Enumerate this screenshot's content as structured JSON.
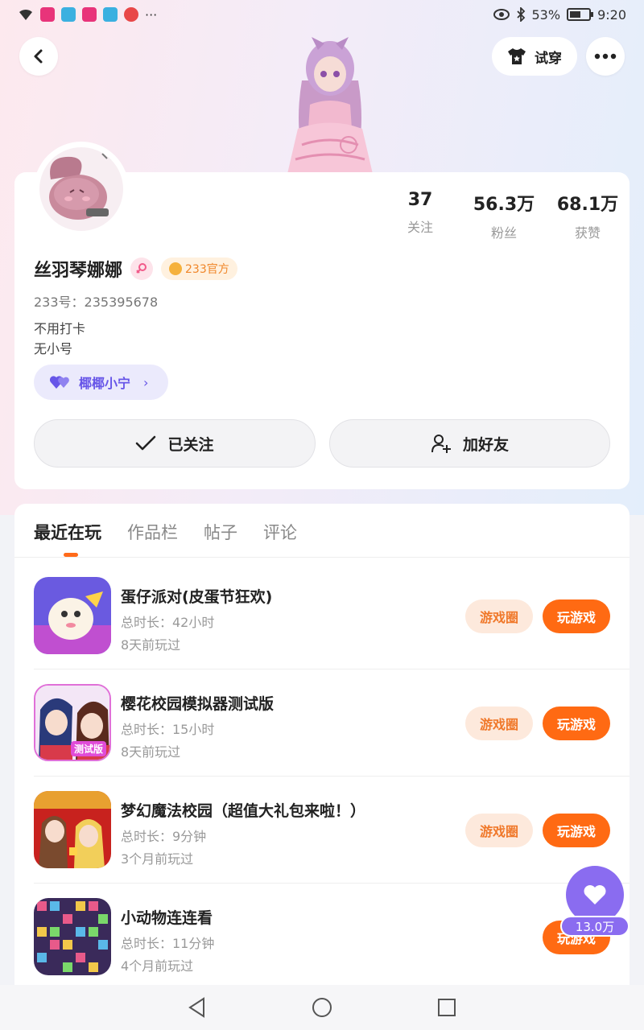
{
  "status_bar": {
    "battery_pct": "53%",
    "time": "9:20",
    "more_indicator": "···"
  },
  "header": {
    "back_icon": "chevron-left-icon",
    "try_on_label": "试穿",
    "more_icon": "more-dots-icon"
  },
  "profile": {
    "stats": [
      {
        "value": "37",
        "label": "关注"
      },
      {
        "value": "56.3万",
        "label": "粉丝"
      },
      {
        "value": "68.1万",
        "label": "获赞"
      }
    ],
    "username": "丝羽琴娜娜",
    "official_badge": "233官方",
    "user_id": "233号：235395678",
    "bio": [
      "不用打卡",
      "无小号"
    ],
    "cp_tag": "椰椰小宁",
    "follow_label": "已关注",
    "add_friend_label": "加好友"
  },
  "tabs": [
    {
      "label": "最近在玩",
      "active": true
    },
    {
      "label": "作品栏",
      "active": false
    },
    {
      "label": "帖子",
      "active": false
    },
    {
      "label": "评论",
      "active": false
    }
  ],
  "games": [
    {
      "title": "蛋仔派对(皮蛋节狂欢)",
      "duration": "总时长：42小时",
      "last_played": "8天前玩过",
      "circle_label": "游戏圈",
      "play_label": "玩游戏"
    },
    {
      "title": "樱花校园模拟器测试版",
      "duration": "总时长：15小时",
      "last_played": "8天前玩过",
      "circle_label": "游戏圈",
      "play_label": "玩游戏",
      "icon_text": "测试版"
    },
    {
      "title": "梦幻魔法校园（超值大礼包来啦！）",
      "duration": "总时长：9分钟",
      "last_played": "3个月前玩过",
      "circle_label": "游戏圈",
      "play_label": "玩游戏"
    },
    {
      "title": "小动物连连看",
      "duration": "总时长：11分钟",
      "last_played": "4个月前玩过",
      "play_label": "玩游戏"
    }
  ],
  "like_float": {
    "count": "13.0万"
  },
  "colors": {
    "accent_orange": "#ff6a13",
    "accent_purple": "#8a6cf0"
  }
}
